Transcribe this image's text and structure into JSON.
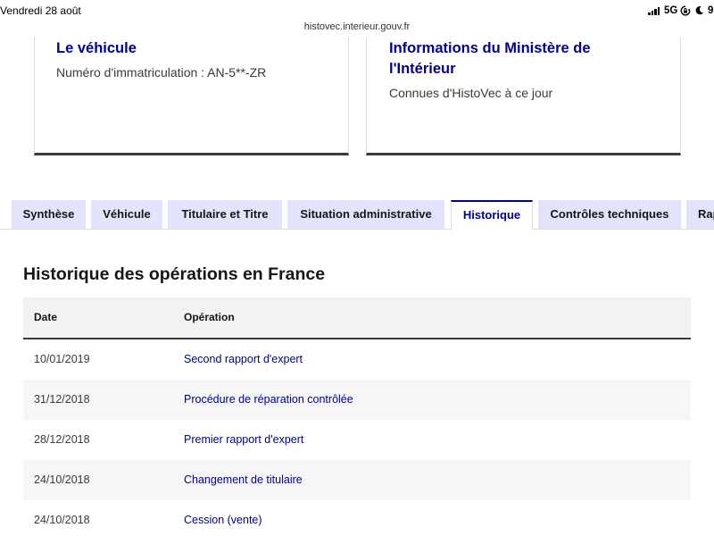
{
  "status_bar": {
    "date": "Vendredi 28 août",
    "network": "5G",
    "battery": "9",
    "icons": [
      "signal-icon",
      "orientation-lock-icon",
      "moon-icon"
    ]
  },
  "browser": {
    "url": "histovec.interieur.gouv.fr"
  },
  "cards": [
    {
      "title": "Le véhicule",
      "text": "Numéro d'immatriculation : AN-5**-ZR"
    },
    {
      "title": "Informations du Ministère de l'Intérieur",
      "text": "Connues d'HistoVec à ce jour"
    }
  ],
  "tabs": [
    {
      "label": "Synthèse",
      "active": false
    },
    {
      "label": "Véhicule",
      "active": false
    },
    {
      "label": "Titulaire et Titre",
      "active": false
    },
    {
      "label": "Situation administrative",
      "active": false
    },
    {
      "label": "Historique",
      "active": true
    },
    {
      "label": "Contrôles techniques",
      "active": false
    },
    {
      "label": "Rap",
      "active": false
    }
  ],
  "history": {
    "title": "Historique des opérations en France",
    "columns": [
      "Date",
      "Opération"
    ],
    "rows": [
      {
        "date": "10/01/2019",
        "operation": "Second rapport d'expert"
      },
      {
        "date": "31/12/2018",
        "operation": "Procédure de réparation contrôlée"
      },
      {
        "date": "28/12/2018",
        "operation": "Premier rapport d'expert"
      },
      {
        "date": "24/10/2018",
        "operation": "Changement de titulaire"
      },
      {
        "date": "24/10/2018",
        "operation": "Cession (vente)"
      }
    ]
  },
  "colors": {
    "brand_blue": "#000091",
    "tab_background": "#e3e3fd",
    "text": "#161616",
    "card_bottom_border": "#3a3a3a",
    "striped_row": "#f6f6f6"
  }
}
